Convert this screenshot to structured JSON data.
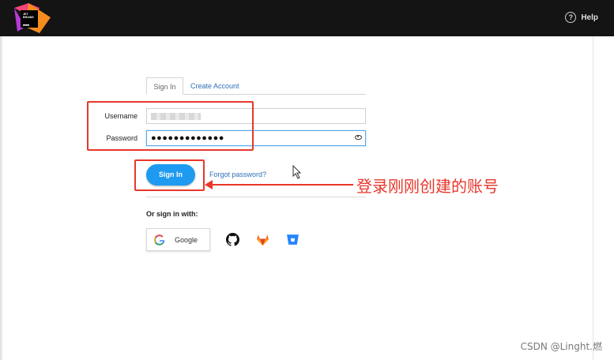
{
  "header": {
    "help_label": "Help",
    "help_icon": "question-circle-icon",
    "logo_icon": "jetbrains-logo"
  },
  "tabs": [
    {
      "label": "Sign In",
      "active": true
    },
    {
      "label": "Create Account",
      "active": false
    }
  ],
  "form": {
    "username_label": "Username",
    "username_value": "",
    "password_label": "Password",
    "password_value": "●●●●●●●●●●●●●",
    "signin_label": "Sign In",
    "forgot_label": "Forgot password?"
  },
  "social": {
    "or_label": "Or sign in with:",
    "google_label": "Google",
    "providers": [
      "github-icon",
      "gitlab-icon",
      "bitbucket-icon"
    ]
  },
  "annotation": {
    "text": "登录刚刚创建的账号"
  },
  "watermark": "CSDN @Linght.燃",
  "colors": {
    "accent": "#1e9bf0",
    "link": "#2d6fb8",
    "annotation_red": "#e8372b",
    "topbar": "#141414"
  }
}
